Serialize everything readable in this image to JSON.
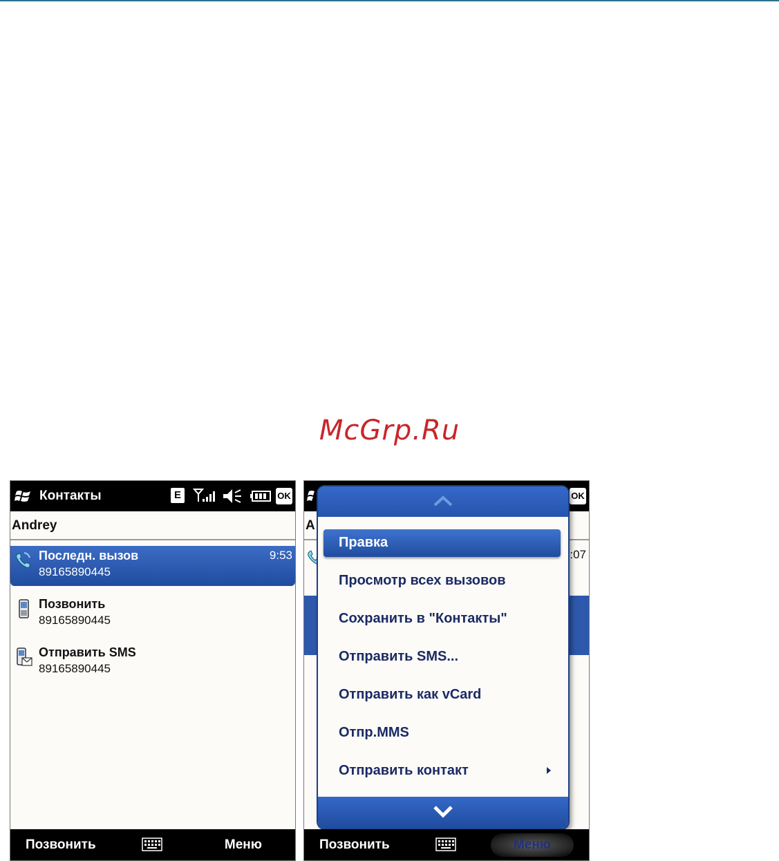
{
  "watermark": "McGrp.Ru",
  "left_screen": {
    "title": "Контакты",
    "status": {
      "network_letter": "E",
      "ok_label": "OK"
    },
    "contact_name": "Andrey",
    "rows": [
      {
        "title": "Последн. вызов",
        "subtitle": "89165890445",
        "time": "9:53"
      },
      {
        "title": "Позвонить",
        "subtitle": "89165890445"
      },
      {
        "title": "Отправить SMS",
        "subtitle": "89165890445"
      }
    ],
    "softkeys": {
      "left": "Позвонить",
      "right": "Меню"
    }
  },
  "right_screen": {
    "status": {
      "ok_label": "OK"
    },
    "contact_name_partial": "A",
    "row_time_partial": ":07",
    "menu": {
      "items": [
        {
          "label": "Правка"
        },
        {
          "label": "Просмотр всех вызовов"
        },
        {
          "label": "Сохранить в \"Контакты\""
        },
        {
          "label": "Отправить SMS..."
        },
        {
          "label": "Отправить как vCard"
        },
        {
          "label": "Отпр.MMS"
        },
        {
          "label": "Отправить контакт"
        }
      ],
      "active_index": 0
    },
    "softkeys": {
      "left": "Позвонить",
      "right": "Меню"
    }
  },
  "colors": {
    "selection_blue": "#2d58ac",
    "menu_text": "#1b2a64",
    "watermark_red": "#c8262a"
  }
}
